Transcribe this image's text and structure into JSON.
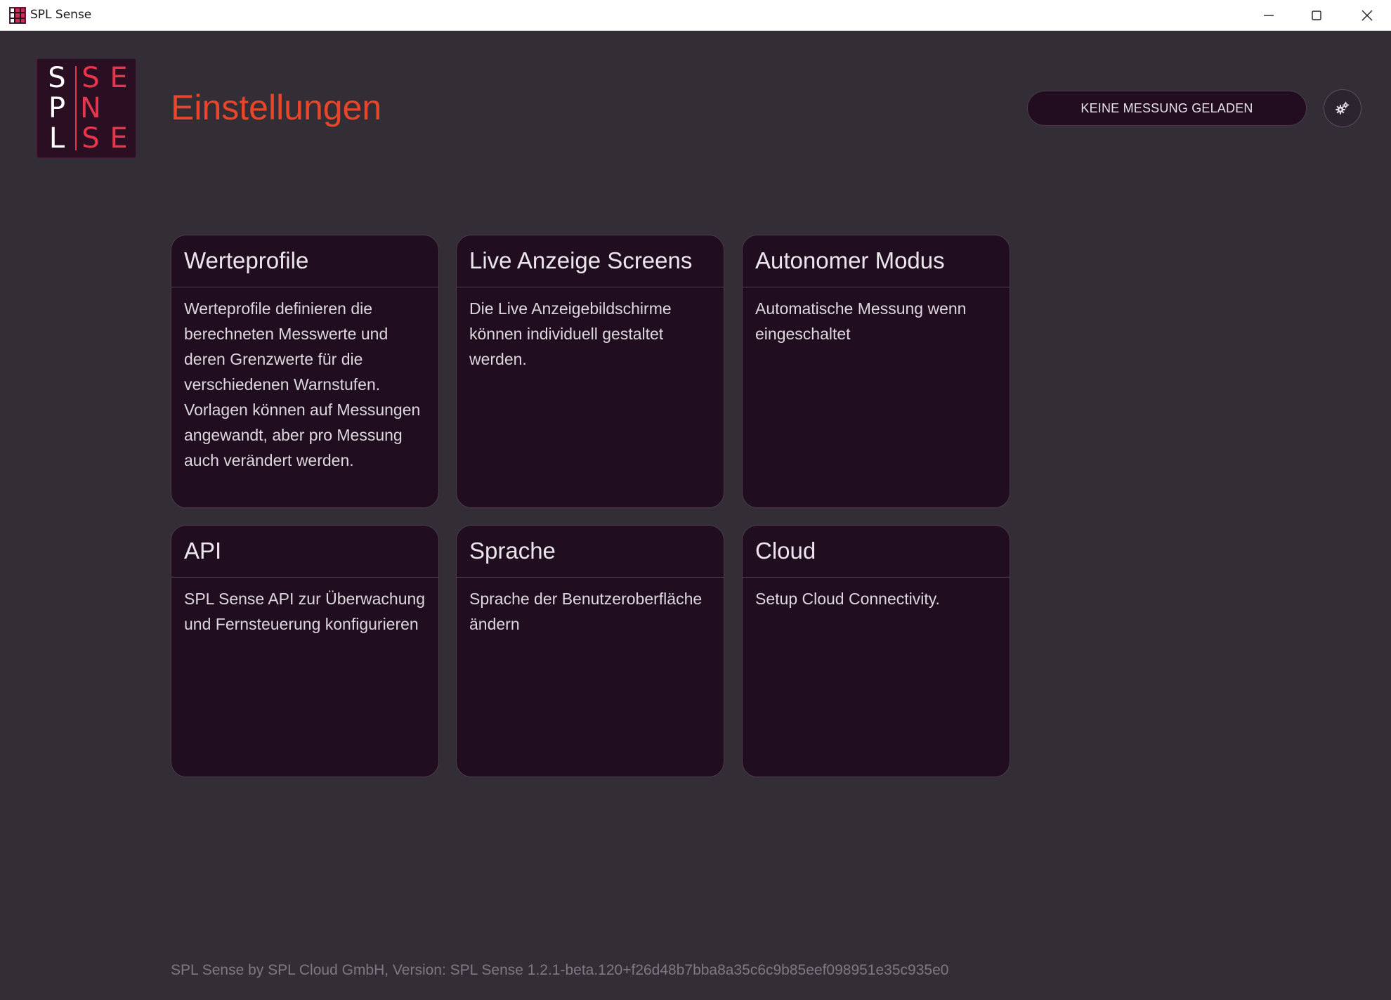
{
  "window": {
    "title": "SPL Sense"
  },
  "logo": {
    "col1": [
      "S",
      "P",
      "L"
    ],
    "col2": [
      "S",
      "N",
      "S"
    ],
    "col3": [
      "E",
      "",
      "E"
    ]
  },
  "header": {
    "title": "Einstellungen",
    "measurement_button": "KEINE MESSUNG GELADEN"
  },
  "cards": [
    {
      "title": "Werteprofile",
      "description": "Werteprofile definieren die berechneten Messwerte und deren Grenzwerte für die verschiedenen Warnstufen. Vorlagen können auf Messungen angewandt, aber pro Messung auch verändert werden."
    },
    {
      "title": "Live Anzeige Screens",
      "description": "Die Live Anzeigebildschirme können individuell gestaltet werden."
    },
    {
      "title": "Autonomer Modus",
      "description": "Automatische Messung wenn eingeschaltet"
    },
    {
      "title": "API",
      "description": "SPL Sense API zur Überwachung und Fernsteuerung konfigurieren"
    },
    {
      "title": "Sprache",
      "description": "Sprache der Benutzeroberfläche ändern"
    },
    {
      "title": "Cloud",
      "description": "Setup Cloud Connectivity."
    }
  ],
  "footer": {
    "text": "SPL Sense by SPL Cloud GmbH, Version: SPL Sense 1.2.1-beta.120+f26d48b7bba8a35c6c9b85eef098951e35c935e0"
  },
  "colors": {
    "background": "#332e35",
    "card": "#200d1f",
    "accent_title": "#e8452a",
    "logo_red": "#e8354e"
  },
  "icons": {
    "settings": "gears-icon",
    "minimize": "minimize-icon",
    "maximize": "maximize-icon",
    "close": "close-icon"
  }
}
